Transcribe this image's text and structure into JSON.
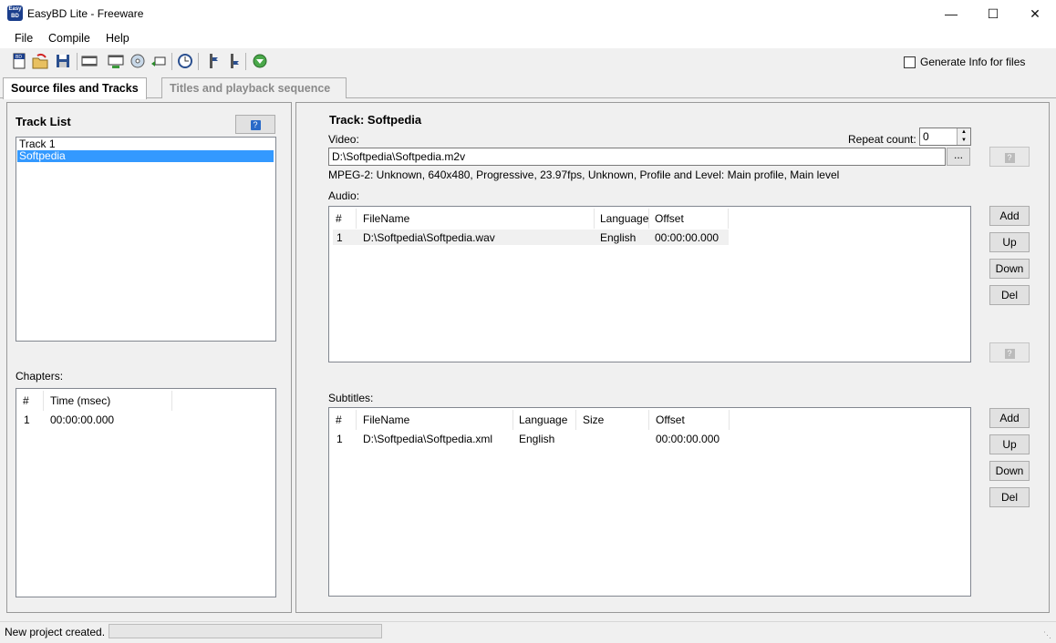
{
  "window": {
    "title": "EasyBD Lite - Freeware",
    "icon_text": "Easy BD",
    "controls": [
      "minimize-icon",
      "maximize-icon",
      "close-icon"
    ]
  },
  "menu": [
    "File",
    "Compile",
    "Help"
  ],
  "toolbar": {
    "icons": [
      "new-project-icon",
      "open-project-icon",
      "save-project-icon",
      "add-video-icon",
      "add-track-icon",
      "burn-disc-icon",
      "import-icon",
      "settings-clock-icon",
      "add-chapter-icon",
      "remove-chapter-icon",
      "compile-icon"
    ],
    "generate_info_label": "Generate Info for files",
    "generate_info_checked": false
  },
  "tabs": [
    {
      "label": "Source files and Tracks",
      "active": true
    },
    {
      "label": "Titles and playback sequence",
      "active": false
    }
  ],
  "left": {
    "track_list_title": "Track List",
    "tracks": [
      {
        "name": "Track 1",
        "selected": false
      },
      {
        "name": "Softpedia",
        "selected": true
      }
    ],
    "chapters_label": "Chapters:",
    "chapters_columns": [
      "#",
      "Time (msec)"
    ],
    "chapters": [
      {
        "num": "1",
        "time": "00:00:00.000"
      }
    ]
  },
  "right": {
    "track_title": "Track: Softpedia",
    "video_label": "Video:",
    "repeat_label": "Repeat count:",
    "repeat_value": "0",
    "video_path": "D:\\Softpedia\\Softpedia.m2v",
    "browse_label": "...",
    "video_info": "MPEG-2: Unknown,  640x480,  Progressive,  23.97fps,  Unknown,  Profile and Level: Main profile,  Main level",
    "audio_label": "Audio:",
    "audio_columns": [
      "#",
      "FileName",
      "Language",
      "Offset"
    ],
    "audio_rows": [
      {
        "num": "1",
        "file": "D:\\Softpedia\\Softpedia.wav",
        "language": "English",
        "offset": "00:00:00.000"
      }
    ],
    "subtitles_label": "Subtitles:",
    "subtitle_columns": [
      "#",
      "FileName",
      "Language",
      "Size",
      "Offset"
    ],
    "subtitle_rows": [
      {
        "num": "1",
        "file": "D:\\Softpedia\\Softpedia.xml",
        "language": "English",
        "size": "",
        "offset": "00:00:00.000"
      }
    ],
    "buttons": {
      "add": "Add",
      "up": "Up",
      "down": "Down",
      "del": "Del"
    }
  },
  "status": {
    "text": "New project created."
  },
  "colors": {
    "selection": "#3399ff",
    "accent": "#1a3e8c"
  }
}
